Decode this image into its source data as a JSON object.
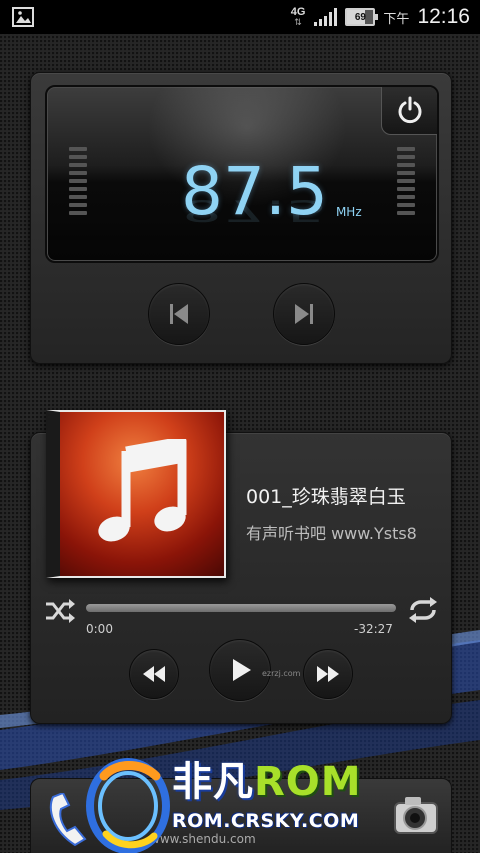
{
  "status_bar": {
    "network": "4G",
    "network_arrows": "⇅",
    "battery_level": "69",
    "ampm": "下午",
    "time": "12:16"
  },
  "fm_radio": {
    "frequency": "87.5",
    "unit": "MHz",
    "icons": [
      "power-icon",
      "prev-station-icon",
      "next-station-icon"
    ]
  },
  "music_player": {
    "title": "001_珍珠翡翠白玉",
    "artist": "有声听书吧 www.Ysts8",
    "elapsed": "0:00",
    "remaining": "-32:27",
    "progress": 0,
    "icons": [
      "shuffle-icon",
      "repeat-icon",
      "rewind-icon",
      "play-icon",
      "fast-forward-icon"
    ],
    "watermark": "ezrzj.com"
  },
  "dock": {
    "website": "www.shendu.com",
    "icons": [
      "phone-icon",
      "camera-icon"
    ]
  },
  "watermark": {
    "brand_cn": "非凡",
    "brand_en": "ROM",
    "url": "ROM.CRSKY.COM"
  },
  "colors": {
    "frequency": "#8fd3f4",
    "brand_green": "#a8e02a",
    "swoosh_blue": "#3a66c8"
  }
}
